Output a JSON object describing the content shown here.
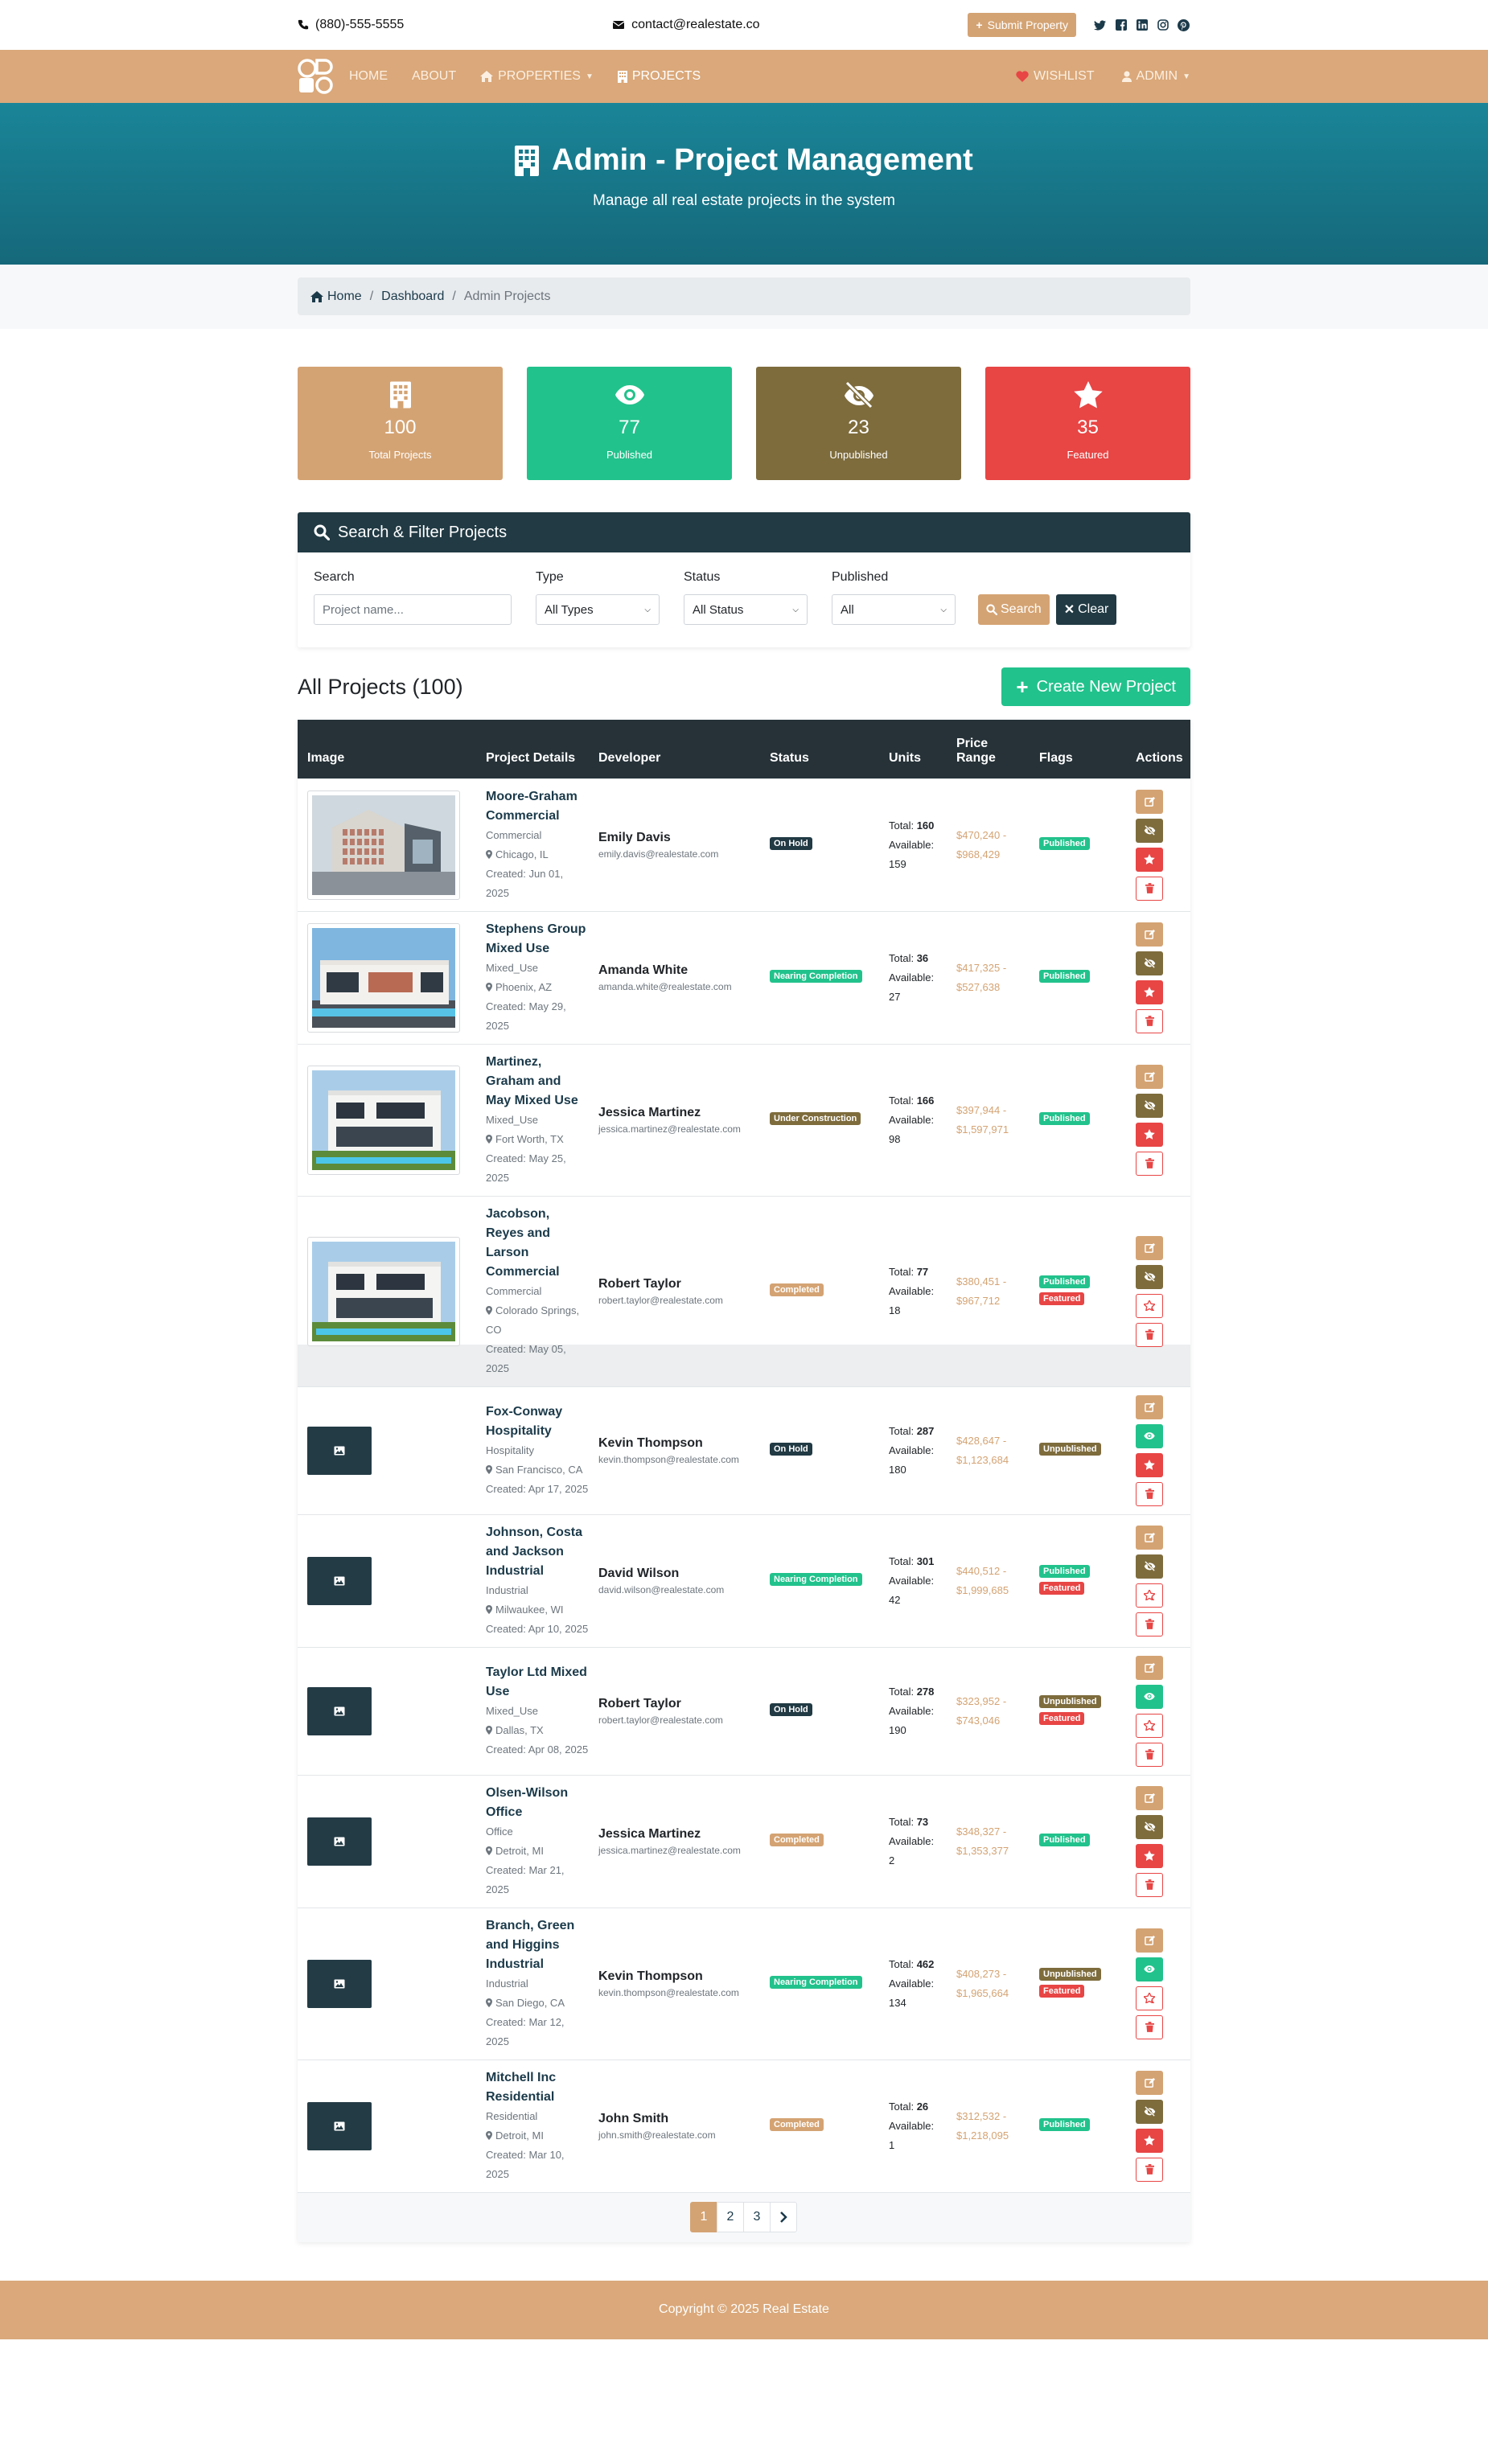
{
  "topbar": {
    "phone": "(880)-555-5555",
    "email": "contact@realestate.co",
    "submit_label": "Submit Property",
    "socials": [
      "twitter-icon",
      "facebook-icon",
      "linkedin-icon",
      "instagram-icon",
      "pinterest-icon"
    ]
  },
  "nav": {
    "home": "HOME",
    "about": "ABOUT",
    "properties": "PROPERTIES",
    "projects": "PROJECTS",
    "wishlist": "WISHLIST",
    "admin": "ADMIN"
  },
  "hero": {
    "title": "Admin - Project Management",
    "subtitle": "Manage all real estate projects in the system"
  },
  "breadcrumb": {
    "home": "Home",
    "dashboard": "Dashboard",
    "current": "Admin Projects"
  },
  "stats": [
    {
      "value": "100",
      "label": "Total Projects",
      "color": "#d4a373",
      "icon": "building-icon"
    },
    {
      "value": "77",
      "label": "Published",
      "color": "#22c28c",
      "icon": "eye-icon"
    },
    {
      "value": "23",
      "label": "Unpublished",
      "color": "#7e6c3d",
      "icon": "eye-slash-icon"
    },
    {
      "value": "35",
      "label": "Featured",
      "color": "#e84545",
      "icon": "star-icon"
    }
  ],
  "filter": {
    "title": "Search & Filter Projects",
    "search_label": "Search",
    "search_placeholder": "Project name...",
    "type_label": "Type",
    "type_value": "All Types",
    "status_label": "Status",
    "status_value": "All Status",
    "published_label": "Published",
    "published_value": "All",
    "search_btn": "Search",
    "clear_btn": "Clear"
  },
  "projects_header": {
    "title": "All Projects (100)",
    "create_btn": "Create New Project"
  },
  "table": {
    "headers": [
      "Image",
      "Project Details",
      "Developer",
      "Status",
      "Units",
      "Price\nRange",
      "Flags",
      "Actions"
    ],
    "total_prefix": "Total:",
    "available_prefix": "Available:",
    "rows": [
      {
        "name": "Moore-Graham Commercial",
        "type": "Commercial",
        "location": "Chicago, IL",
        "created": "Created: Jun 01, 2025",
        "developer": "Emily Davis",
        "dev_email": "emily.davis@realestate.com",
        "status": "On Hold",
        "status_class": "b-onhold",
        "total": "160",
        "available": "159",
        "price_min": "$470,240 -",
        "price_max": "$968,429",
        "flags": [
          "Published"
        ],
        "image": "photo1",
        "published": true,
        "featured": true
      },
      {
        "name": "Stephens Group Mixed Use",
        "type": "Mixed_Use",
        "location": "Phoenix, AZ",
        "created": "Created: May 29, 2025",
        "developer": "Amanda White",
        "dev_email": "amanda.white@realestate.com",
        "status": "Nearing Completion",
        "status_class": "b-nearing",
        "total": "36",
        "available": "27",
        "price_min": "$417,325 -",
        "price_max": "$527,638",
        "flags": [
          "Published"
        ],
        "image": "photo2",
        "published": true,
        "featured": true
      },
      {
        "name": "Martinez, Graham and May Mixed Use",
        "type": "Mixed_Use",
        "location": "Fort Worth, TX",
        "created": "Created: May 25, 2025",
        "developer": "Jessica Martinez",
        "dev_email": "jessica.martinez@realestate.com",
        "status": "Under Construction",
        "status_class": "b-under",
        "total": "166",
        "available": "98",
        "price_min": "$397,944 -",
        "price_max": "$1,597,971",
        "flags": [
          "Published"
        ],
        "image": "photo3",
        "published": true,
        "featured": true
      },
      {
        "name": "Jacobson, Reyes and Larson Commercial",
        "type": "Commercial",
        "location": "Colorado Springs, CO",
        "created": "Created: May 05, 2025",
        "developer": "Robert Taylor",
        "dev_email": "robert.taylor@realestate.com",
        "status": "Completed",
        "status_class": "b-completed",
        "total": "77",
        "available": "18",
        "price_min": "$380,451 -",
        "price_max": "$967,712",
        "flags": [
          "Published",
          "Featured"
        ],
        "image": "photo3",
        "published": true,
        "featured": false
      },
      {
        "name": "Fox-Conway Hospitality",
        "type": "Hospitality",
        "location": "San Francisco, CA",
        "created": "Created: Apr 17, 2025",
        "developer": "Kevin Thompson",
        "dev_email": "kevin.thompson@realestate.com",
        "status": "On Hold",
        "status_class": "b-onhold",
        "total": "287",
        "available": "180",
        "price_min": "$428,647 -",
        "price_max": "$1,123,684",
        "flags": [
          "Unpublished"
        ],
        "image": "none",
        "published": false,
        "featured": true
      },
      {
        "name": "Johnson, Costa and Jackson Industrial",
        "type": "Industrial",
        "location": "Milwaukee, WI",
        "created": "Created: Apr 10, 2025",
        "developer": "David Wilson",
        "dev_email": "david.wilson@realestate.com",
        "status": "Nearing Completion",
        "status_class": "b-nearing",
        "total": "301",
        "available": "42",
        "price_min": "$440,512 -",
        "price_max": "$1,999,685",
        "flags": [
          "Published",
          "Featured"
        ],
        "image": "none",
        "published": true,
        "featured": false
      },
      {
        "name": "Taylor Ltd Mixed Use",
        "type": "Mixed_Use",
        "location": "Dallas, TX",
        "created": "Created: Apr 08, 2025",
        "developer": "Robert Taylor",
        "dev_email": "robert.taylor@realestate.com",
        "status": "On Hold",
        "status_class": "b-onhold",
        "total": "278",
        "available": "190",
        "price_min": "$323,952 -",
        "price_max": "$743,046",
        "flags": [
          "Unpublished",
          "Featured"
        ],
        "image": "none",
        "published": false,
        "featured": false
      },
      {
        "name": "Olsen-Wilson Office",
        "type": "Office",
        "location": "Detroit, MI",
        "created": "Created: Mar 21, 2025",
        "developer": "Jessica Martinez",
        "dev_email": "jessica.martinez@realestate.com",
        "status": "Completed",
        "status_class": "b-completed",
        "total": "73",
        "available": "2",
        "price_min": "$348,327 -",
        "price_max": "$1,353,377",
        "flags": [
          "Published"
        ],
        "image": "none",
        "published": true,
        "featured": true
      },
      {
        "name": "Branch, Green and Higgins Industrial",
        "type": "Industrial",
        "location": "San Diego, CA",
        "created": "Created: Mar 12, 2025",
        "developer": "Kevin Thompson",
        "dev_email": "kevin.thompson@realestate.com",
        "status": "Nearing Completion",
        "status_class": "b-nearing",
        "total": "462",
        "available": "134",
        "price_min": "$408,273 -",
        "price_max": "$1,965,664",
        "flags": [
          "Unpublished",
          "Featured"
        ],
        "image": "none",
        "published": false,
        "featured": false
      },
      {
        "name": "Mitchell Inc Residential",
        "type": "Residential",
        "location": "Detroit, MI",
        "created": "Created: Mar 10, 2025",
        "developer": "John Smith",
        "dev_email": "john.smith@realestate.com",
        "status": "Completed",
        "status_class": "b-completed",
        "total": "26",
        "available": "1",
        "price_min": "$312,532 -",
        "price_max": "$1,218,095",
        "flags": [
          "Published"
        ],
        "image": "none",
        "published": true,
        "featured": true
      }
    ]
  },
  "pagination": {
    "pages": [
      "1",
      "2",
      "3"
    ],
    "active": "1"
  },
  "footer": {
    "text": "Copyright © 2025 Real Estate"
  }
}
